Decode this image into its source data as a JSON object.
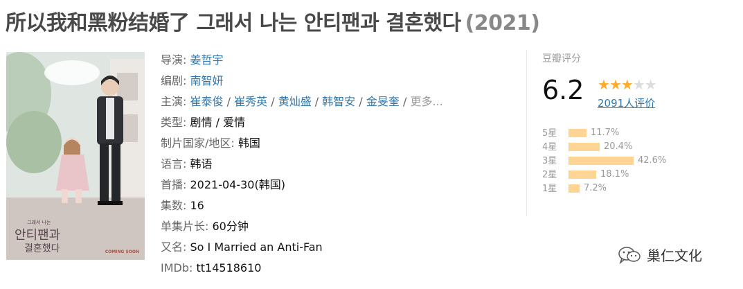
{
  "title": "所以我和黑粉结婚了 그래서 나는 안티팬과 결혼했다",
  "year": "(2021)",
  "poster": {
    "korean_title_lines": [
      "그래서 나는",
      "안티팬과",
      "결혼했다"
    ],
    "coming_soon": "COMING SOON",
    "speech": [
      ""
    ]
  },
  "info": {
    "director_label": "导演:",
    "director": "姜哲宇",
    "writer_label": "编剧:",
    "writer": "南智妍",
    "cast_label": "主演:",
    "cast": [
      "崔泰俊",
      "崔秀英",
      "黄灿盛",
      "韩智安",
      "金旻奎"
    ],
    "cast_more": "更多...",
    "genre_label": "类型:",
    "genre": "剧情 / 爱情",
    "country_label": "制片国家/地区:",
    "country": "韩国",
    "language_label": "语言:",
    "language": "韩语",
    "premiere_label": "首播:",
    "premiere": "2021-04-30(韩国)",
    "episodes_label": "集数:",
    "episodes": "16",
    "runtime_label": "单集片长:",
    "runtime": "60分钟",
    "aka_label": "又名:",
    "aka": "So I Married an Anti-Fan",
    "imdb_label": "IMDb:",
    "imdb": "tt14518610"
  },
  "rating": {
    "title": "豆瓣评分",
    "score": "6.2",
    "stars_filled": 3,
    "stars_total": 5,
    "count": "2091人评价",
    "distribution": [
      {
        "label": "5星",
        "percent": 11.7,
        "text": "11.7%"
      },
      {
        "label": "4星",
        "percent": 20.4,
        "text": "20.4%"
      },
      {
        "label": "3星",
        "percent": 42.6,
        "text": "42.6%"
      },
      {
        "label": "2星",
        "percent": 18.1,
        "text": "18.1%"
      },
      {
        "label": "1星",
        "percent": 7.2,
        "text": "7.2%"
      }
    ]
  },
  "watermark": "巢仁文化",
  "colors": {
    "link": "#3377aa",
    "star": "#ffac2d",
    "bar": "#ffd596"
  }
}
